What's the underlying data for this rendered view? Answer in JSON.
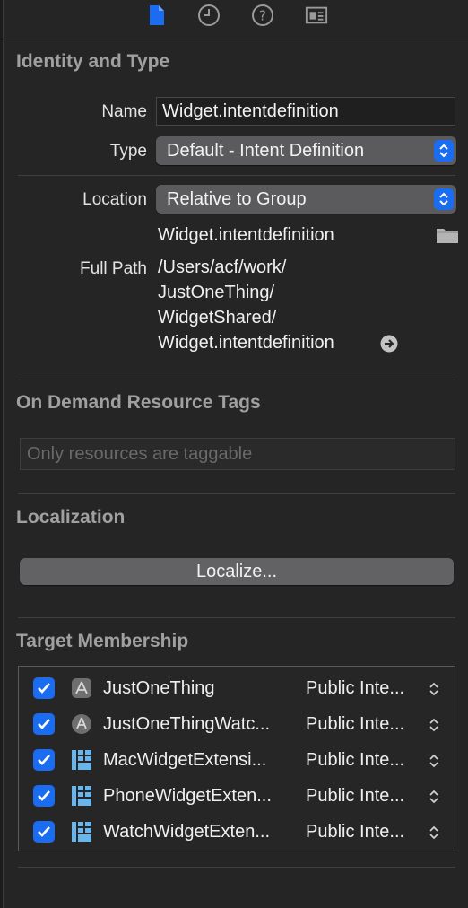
{
  "toolbar": {
    "icons": [
      "file-inspector-icon",
      "history-inspector-icon",
      "quick-help-icon",
      "identity-inspector-icon"
    ],
    "accent": "#1a6cf0"
  },
  "identity": {
    "title": "Identity and Type",
    "name_label": "Name",
    "name_value": "Widget.intentdefinition",
    "type_label": "Type",
    "type_value": "Default - Intent Definition",
    "location_label": "Location",
    "location_value": "Relative to Group",
    "file_name": "Widget.intentdefinition",
    "full_path_label": "Full Path",
    "full_path_lines": [
      "/Users/acf/work/",
      "JustOneThing/",
      "WidgetShared/",
      "Widget.intentdefinition"
    ]
  },
  "on_demand": {
    "title": "On Demand Resource Tags",
    "placeholder": "Only resources are taggable"
  },
  "localization": {
    "title": "Localization",
    "button_label": "Localize..."
  },
  "target_membership": {
    "title": "Target Membership",
    "targets": [
      {
        "name": "JustOneThing",
        "visibility": "Public Inte...",
        "checked": true,
        "icon": "app-icon"
      },
      {
        "name": "JustOneThingWatc...",
        "visibility": "Public Inte...",
        "checked": true,
        "icon": "watch-app-icon"
      },
      {
        "name": "MacWidgetExtensi...",
        "visibility": "Public Inte...",
        "checked": true,
        "icon": "widget-extension-icon"
      },
      {
        "name": "PhoneWidgetExten...",
        "visibility": "Public Inte...",
        "checked": true,
        "icon": "widget-extension-icon"
      },
      {
        "name": "WatchWidgetExten...",
        "visibility": "Public Inte...",
        "checked": true,
        "icon": "widget-extension-icon"
      }
    ]
  }
}
